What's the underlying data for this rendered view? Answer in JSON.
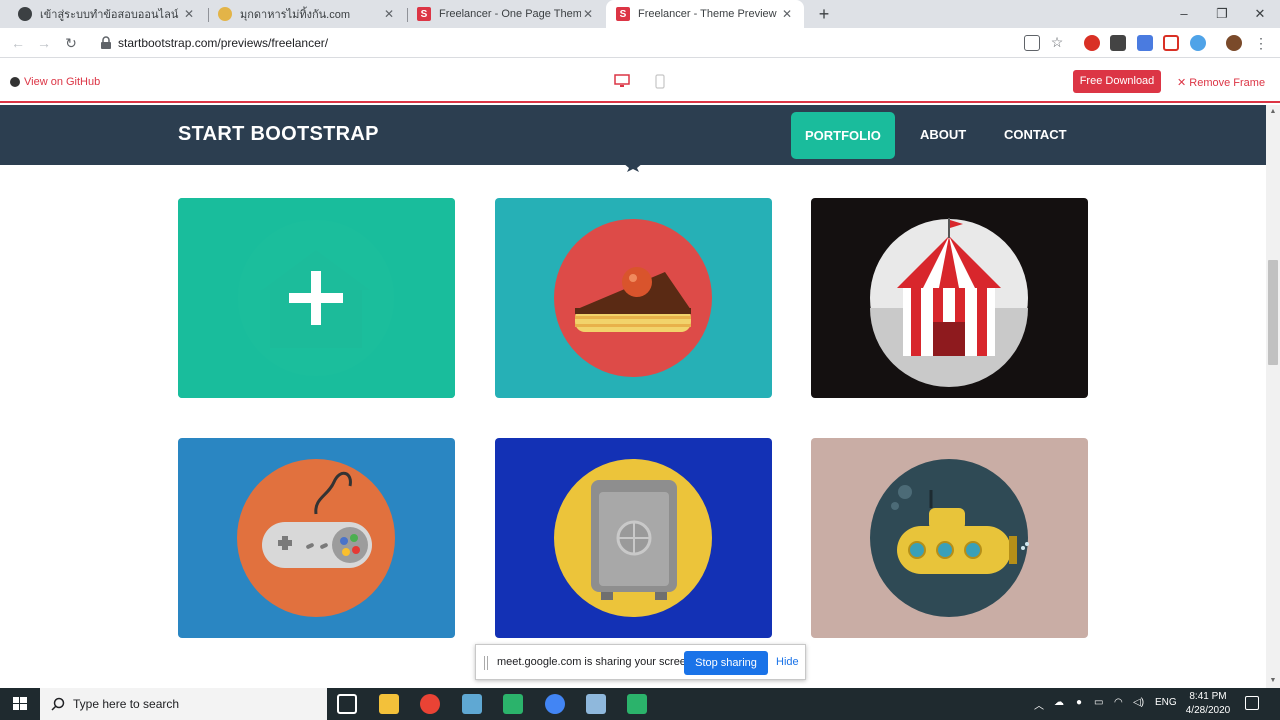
{
  "browser": {
    "tabs": [
      {
        "title": "เข้าสู่ระบบทำข้อสอบออนไลน์ แบบมีระบบ"
      },
      {
        "title": "มุกดาหารไม่ทิ้งกัน.com"
      },
      {
        "title": "Freelancer - One Page Theme - S"
      },
      {
        "title": "Freelancer - Theme Preview - Sta"
      }
    ],
    "new_tab": "+",
    "url": "startbootstrap.com/previews/freelancer/"
  },
  "preview_bar": {
    "github_label": "View on GitHub",
    "download_label": "Free Download",
    "remove_frame_label": "Remove Frame"
  },
  "site": {
    "brand": "START BOOTSTRAP",
    "nav": [
      "PORTFOLIO",
      "ABOUT",
      "CONTACT"
    ],
    "active_nav": "PORTFOLIO",
    "accent_color": "#1abc9c",
    "navbar_color": "#2c3e50"
  },
  "portfolio": {
    "items": [
      {
        "name": "cabin",
        "bg": "#1abc9c",
        "hovered": true
      },
      {
        "name": "cake",
        "bg": "#26b0b6"
      },
      {
        "name": "circus",
        "bg": "#141010"
      },
      {
        "name": "game",
        "bg": "#2a86c2"
      },
      {
        "name": "safe",
        "bg": "#1331b5"
      },
      {
        "name": "submarine",
        "bg": "#c9ada5"
      }
    ]
  },
  "screen_share": {
    "message": "meet.google.com is sharing your screen.",
    "stop_label": "Stop sharing",
    "hide_label": "Hide"
  },
  "taskbar": {
    "search_placeholder": "Type here to search",
    "language": "ENG",
    "time": "8:41 PM",
    "date": "4/28/2020"
  }
}
